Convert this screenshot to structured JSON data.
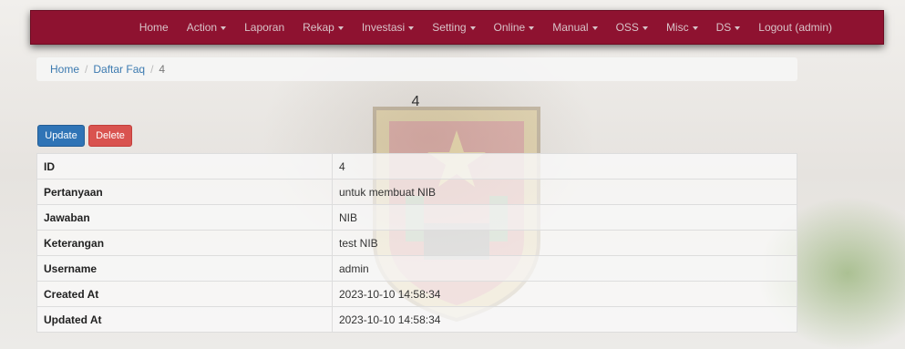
{
  "nav": {
    "items": [
      {
        "label": "Home",
        "dropdown": false
      },
      {
        "label": "Action",
        "dropdown": true
      },
      {
        "label": "Laporan",
        "dropdown": false
      },
      {
        "label": "Rekap",
        "dropdown": true
      },
      {
        "label": "Investasi",
        "dropdown": true
      },
      {
        "label": "Setting",
        "dropdown": true
      },
      {
        "label": "Online",
        "dropdown": true
      },
      {
        "label": "Manual",
        "dropdown": true
      },
      {
        "label": "OSS",
        "dropdown": true
      },
      {
        "label": "Misc",
        "dropdown": true
      },
      {
        "label": "DS",
        "dropdown": true
      },
      {
        "label": "Logout (admin)",
        "dropdown": false
      }
    ],
    "color": "#8e1230"
  },
  "breadcrumb": {
    "home": "Home",
    "list": "Daftar Faq",
    "current": "4"
  },
  "title": "4",
  "buttons": {
    "update": "Update",
    "delete": "Delete"
  },
  "detail": {
    "rows": [
      {
        "label": "ID",
        "value": "4"
      },
      {
        "label": "Pertanyaan",
        "value": "untuk membuat NIB"
      },
      {
        "label": "Jawaban",
        "value": "NIB"
      },
      {
        "label": "Keterangan",
        "value": "test NIB"
      },
      {
        "label": "Username",
        "value": "admin"
      },
      {
        "label": "Created At",
        "value": "2023-10-10 14:58:34"
      },
      {
        "label": "Updated At",
        "value": "2023-10-10 14:58:34"
      }
    ]
  }
}
